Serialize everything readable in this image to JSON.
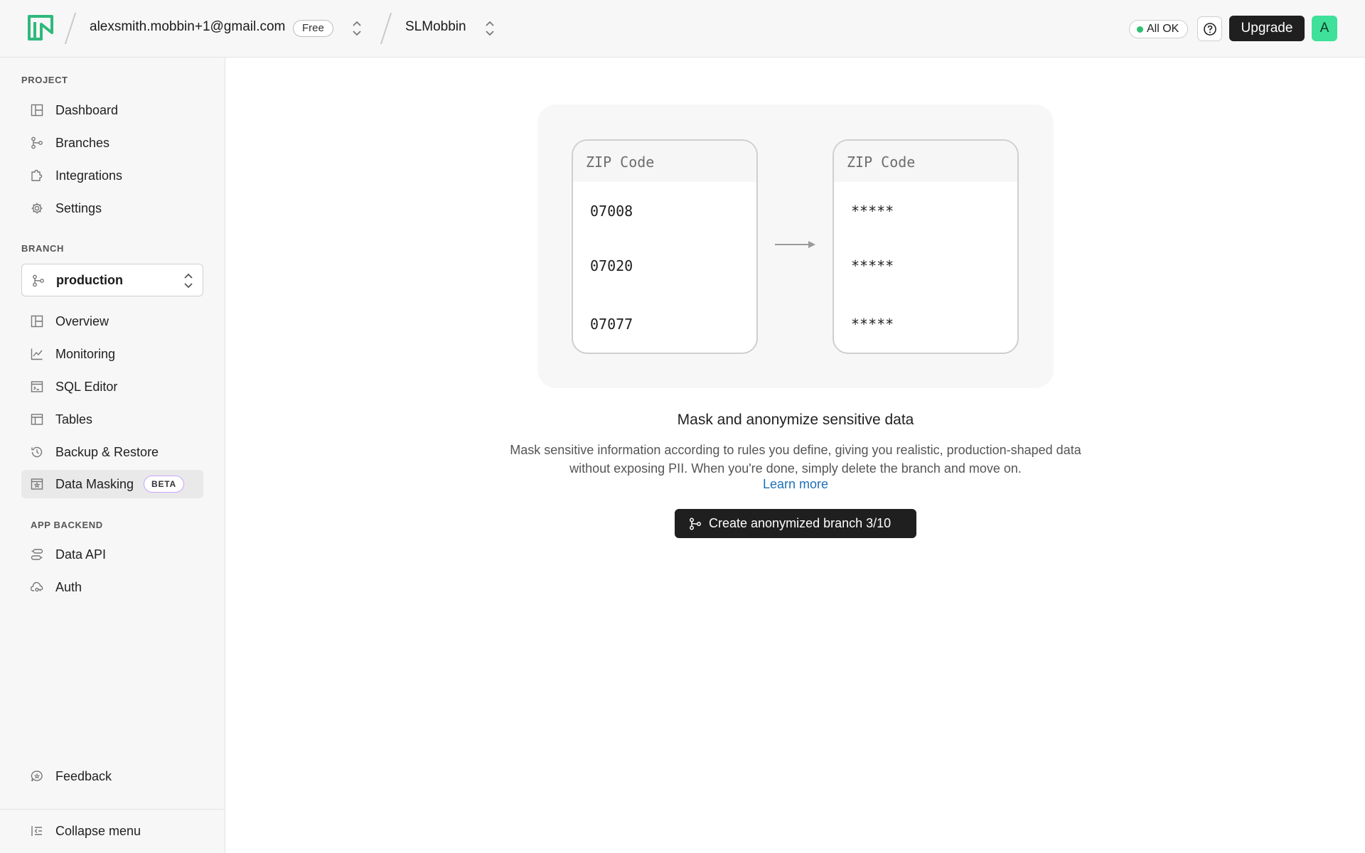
{
  "header": {
    "account_email": "alexsmith.mobbin+1@gmail.com",
    "plan_badge": "Free",
    "project_name": "SLMobbin",
    "status": "All OK",
    "upgrade_label": "Upgrade",
    "avatar_initial": "A",
    "brand_color": "#2fb97a"
  },
  "sidebar": {
    "project_label": "PROJECT",
    "project_items": [
      {
        "label": "Dashboard",
        "icon": "dashboard-icon"
      },
      {
        "label": "Branches",
        "icon": "branch-icon"
      },
      {
        "label": "Integrations",
        "icon": "puzzle-icon"
      },
      {
        "label": "Settings",
        "icon": "gear-icon"
      }
    ],
    "branch_label": "BRANCH",
    "branch_value": "production",
    "branch_items": [
      {
        "label": "Overview",
        "icon": "dashboard-icon"
      },
      {
        "label": "Monitoring",
        "icon": "chart-icon"
      },
      {
        "label": "SQL Editor",
        "icon": "terminal-icon"
      },
      {
        "label": "Tables",
        "icon": "table-icon"
      },
      {
        "label": "Backup & Restore",
        "icon": "history-icon"
      },
      {
        "label": "Data Masking",
        "icon": "mask-icon",
        "badge": "BETA",
        "active": true
      }
    ],
    "backend_label": "APP BACKEND",
    "backend_items": [
      {
        "label": "Data API",
        "icon": "api-icon"
      },
      {
        "label": "Auth",
        "icon": "cloud-key-icon"
      }
    ],
    "feedback_label": "Feedback",
    "collapse_label": "Collapse menu"
  },
  "illustration": {
    "column_header": "ZIP Code",
    "original_values": [
      "07008",
      "07020",
      "07077"
    ],
    "masked_values": [
      "*****",
      "*****",
      "*****"
    ]
  },
  "empty_state": {
    "title": "Mask and anonymize sensitive data",
    "description": "Mask sensitive information according to rules you define, giving you realistic, production-shaped data without exposing PII. When you're done, simply delete the branch and move on.",
    "learn_more": "Learn more",
    "cta_label": "Create anonymized branch 3/10"
  }
}
